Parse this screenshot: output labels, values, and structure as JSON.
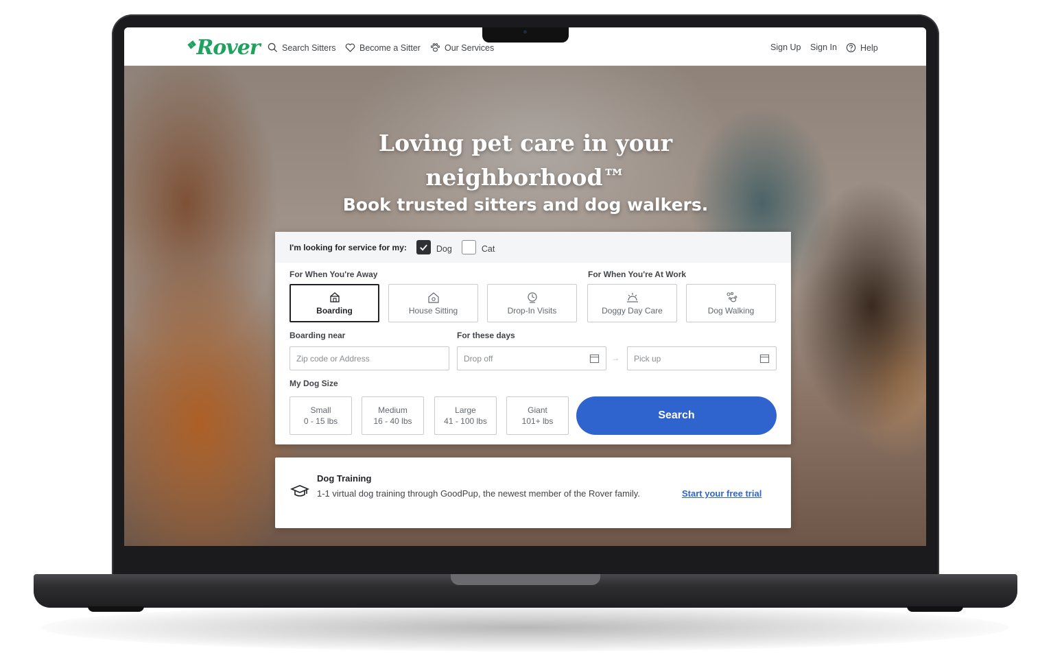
{
  "nav": {
    "logo": "Rover",
    "search_sitters": "Search Sitters",
    "become_sitter": "Become a Sitter",
    "our_services": "Our Services",
    "sign_up": "Sign Up",
    "sign_in": "Sign In",
    "help": "Help"
  },
  "hero": {
    "title": "Loving pet care in your neighborhood™",
    "subtitle": "Book trusted sitters and dog walkers."
  },
  "search": {
    "pet_label": "I'm looking for service for my:",
    "pets": [
      {
        "label": "Dog",
        "checked": true
      },
      {
        "label": "Cat",
        "checked": false
      }
    ],
    "away_label": "For When You're Away",
    "work_label": "For When You're At Work",
    "services": [
      {
        "label": "Boarding",
        "icon": "boarding-icon",
        "selected": true
      },
      {
        "label": "House Sitting",
        "icon": "house-sitting-icon",
        "selected": false
      },
      {
        "label": "Drop-In Visits",
        "icon": "drop-in-icon",
        "selected": false
      },
      {
        "label": "Doggy Day Care",
        "icon": "day-care-icon",
        "selected": false
      },
      {
        "label": "Dog Walking",
        "icon": "dog-walking-icon",
        "selected": false
      }
    ],
    "near_label": "Boarding near",
    "near_placeholder": "Zip code or Address",
    "days_label": "For these days",
    "dropoff_placeholder": "Drop off",
    "pickup_placeholder": "Pick up",
    "size_label": "My Dog Size",
    "sizes": [
      {
        "name": "Small",
        "range": "0 - 15 lbs"
      },
      {
        "name": "Medium",
        "range": "16 - 40 lbs"
      },
      {
        "name": "Large",
        "range": "41 - 100 lbs"
      },
      {
        "name": "Giant",
        "range": "101+ lbs"
      }
    ],
    "search_button": "Search"
  },
  "promo": {
    "title": "Dog Training",
    "body": "1-1 virtual dog training through GoodPup, the newest member of the Rover family.",
    "link": "Start your free trial"
  },
  "colors": {
    "brand_green": "#1fa25e",
    "search_blue": "#2f64cf"
  }
}
